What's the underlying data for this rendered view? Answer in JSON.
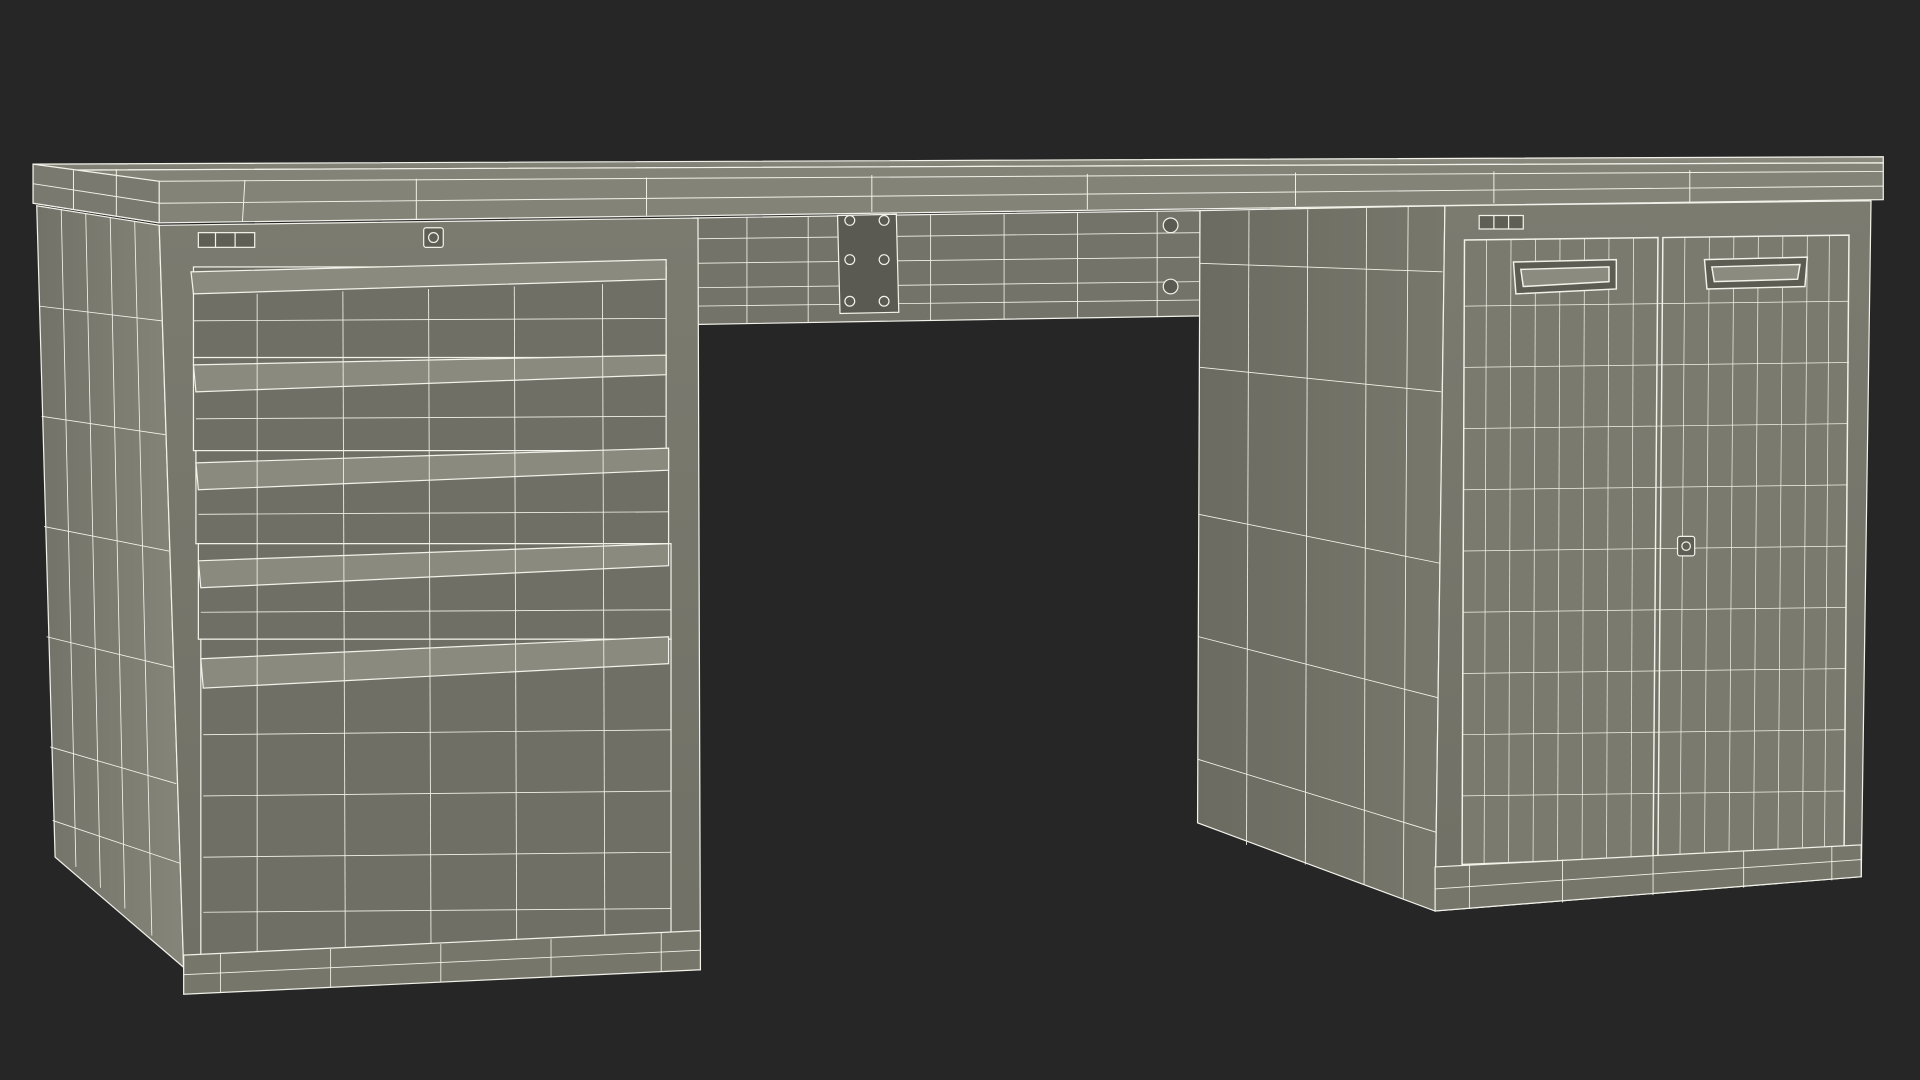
{
  "scene": {
    "subject": "workbench-wireframe",
    "colors": {
      "background": "#262626",
      "surface": "#7a7a6e",
      "surface_top": "#8a8a7e",
      "surface_shadow": "#5f5f55",
      "surface_dark": "#6a6a60",
      "wire": "#f2f2ea",
      "inner": "#4a4a44"
    }
  }
}
